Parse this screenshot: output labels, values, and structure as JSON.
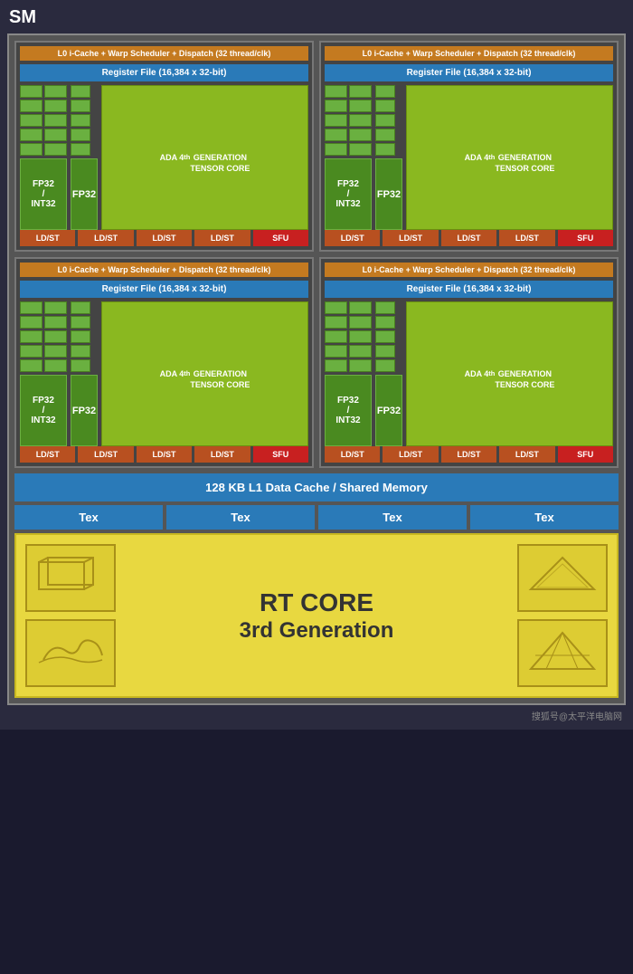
{
  "title": "SM",
  "quadrants": [
    {
      "l0_cache": "L0 i-Cache + Warp Scheduler + Dispatch (32 thread/clk)",
      "register_file": "Register File (16,384 x 32-bit)",
      "fp32_int32_label": "FP32\n/\nINT32",
      "fp32_label": "FP32",
      "tensor_core_label": "ADA 4th\nGENERATION\nTENSOR CORE",
      "ldst_units": [
        "LD/ST",
        "LD/ST",
        "LD/ST",
        "LD/ST"
      ],
      "sfu_label": "SFU"
    },
    {
      "l0_cache": "L0 i-Cache + Warp Scheduler + Dispatch (32 thread/clk)",
      "register_file": "Register File (16,384 x 32-bit)",
      "fp32_int32_label": "FP32\n/\nINT32",
      "fp32_label": "FP32",
      "tensor_core_label": "ADA 4th\nGENERATION\nTENSOR CORE",
      "ldst_units": [
        "LD/ST",
        "LD/ST",
        "LD/ST",
        "LD/ST"
      ],
      "sfu_label": "SFU"
    },
    {
      "l0_cache": "L0 i-Cache + Warp Scheduler + Dispatch (32 thread/clk)",
      "register_file": "Register File (16,384 x 32-bit)",
      "fp32_int32_label": "FP32\n/\nINT32",
      "fp32_label": "FP32",
      "tensor_core_label": "ADA 4th\nGENERATION\nTENSOR CORE",
      "ldst_units": [
        "LD/ST",
        "LD/ST",
        "LD/ST",
        "LD/ST"
      ],
      "sfu_label": "SFU"
    },
    {
      "l0_cache": "L0 i-Cache + Warp Scheduler + Dispatch (32 thread/clk)",
      "register_file": "Register File (16,384 x 32-bit)",
      "fp32_int32_label": "FP32\n/\nINT32",
      "fp32_label": "FP32",
      "tensor_core_label": "ADA 4th\nGENERATION\nTENSOR CORE",
      "ldst_units": [
        "LD/ST",
        "LD/ST",
        "LD/ST",
        "LD/ST"
      ],
      "sfu_label": "SFU"
    }
  ],
  "l1_cache_label": "128 KB L1 Data Cache / Shared Memory",
  "tex_units": [
    "Tex",
    "Tex",
    "Tex",
    "Tex"
  ],
  "rt_core": {
    "title": "RT CORE",
    "generation": "3rd Generation"
  },
  "watermark": "搜狐号@太平洋电脑网",
  "colors": {
    "orange": "#c47a20",
    "blue": "#2a7ab8",
    "green_dark": "#4a8a20",
    "green_mid": "#6ab040",
    "green_tensor": "#8ab820",
    "red_ldst": "#b85020",
    "red_sfu": "#c82020",
    "yellow_rt": "#e8d840"
  }
}
